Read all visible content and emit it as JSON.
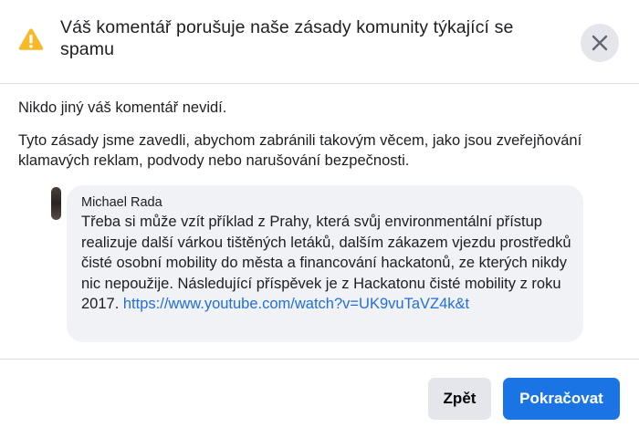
{
  "dialog": {
    "title": "Váš komentář porušuje naše zásady komunity týkající se spamu",
    "icon": "warning-icon",
    "close_icon": "close-icon"
  },
  "body": {
    "line1": "Nikdo jiný váš komentář nevidí.",
    "line2": "Tyto zásady jsme zavedli, abychom zabránili takovým věcem, jako jsou zveřejňování klamavých reklam, podvody nebo narušování bezpečnosti."
  },
  "comment": {
    "author": "Michael Rada",
    "text": "Třeba si může vzít příklad z Prahy, která svůj environmentální přístup realizuje další várkou tištěných letáků, dalším zákazem vjezdu prostředků čisté osobní mobility do města a financování hackatonů, ze kterých nikdy nic nepoužije. Následující příspěvek je z Hackatonu čisté mobility z roku 2017. ",
    "link": "https://www.youtube.com/watch?v=UK9vuTaVZ4k&t"
  },
  "buttons": {
    "back": "Zpět",
    "continue": "Pokračovat"
  },
  "colors": {
    "warning": "#f7b928",
    "primary": "#1b74e4",
    "link": "#216fdb",
    "bubble": "#f0f2f5",
    "secondary_button": "#e4e6eb"
  }
}
